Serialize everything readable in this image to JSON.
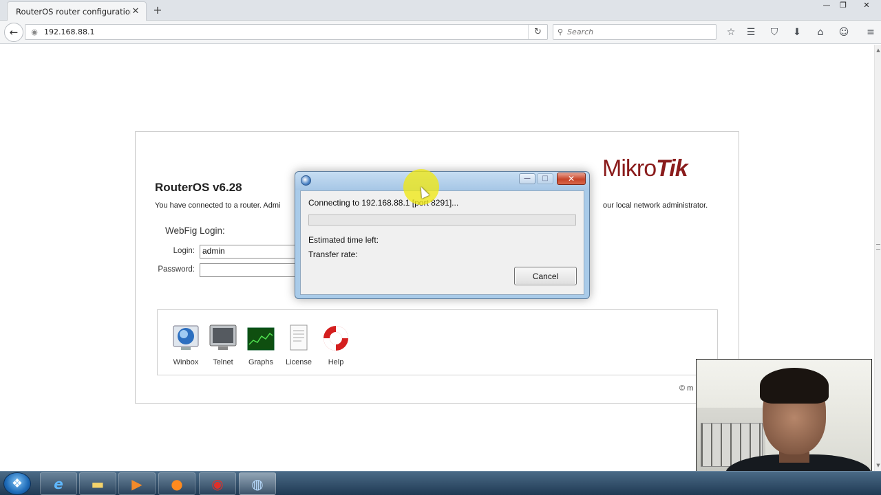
{
  "browser": {
    "tab_title": "RouterOS router configuration ...",
    "tab_close": "✕",
    "new_tab": "+",
    "url": "192.168.88.1",
    "search_placeholder": "Search",
    "window_controls": {
      "minimize": "—",
      "restore": "❐",
      "close": "✕"
    }
  },
  "page": {
    "title": "RouterOS v6.28",
    "intro_left": "You have connected to a router. Admi",
    "intro_right": "our local network administrator.",
    "logo": {
      "left": "Mikro",
      "right": "Tik"
    },
    "login": {
      "heading": "WebFig Login:",
      "login_label": "Login:",
      "login_value": "admin",
      "password_label": "Password:",
      "password_value": ""
    },
    "apps": [
      {
        "label": "Winbox",
        "icon": "winbox-icon"
      },
      {
        "label": "Telnet",
        "icon": "telnet-icon"
      },
      {
        "label": "Graphs",
        "icon": "graphs-icon"
      },
      {
        "label": "License",
        "icon": "license-icon"
      },
      {
        "label": "Help",
        "icon": "help-icon"
      }
    ],
    "copyright": "© m"
  },
  "dialog": {
    "connecting": "Connecting to 192.168.88.1 [port 8291]...",
    "progress_percent": 0,
    "estimated_label": "Estimated time left:",
    "transfer_label": "Transfer rate:",
    "cancel_label": "Cancel",
    "close_glyph": "✕",
    "min_glyph": "—",
    "max_glyph": "□"
  },
  "colors": {
    "brand": "#8a1c1c",
    "dialog_frame": "#a9cbe9",
    "taskbar": "#203a54",
    "cursor_highlight": "#f0e814"
  }
}
